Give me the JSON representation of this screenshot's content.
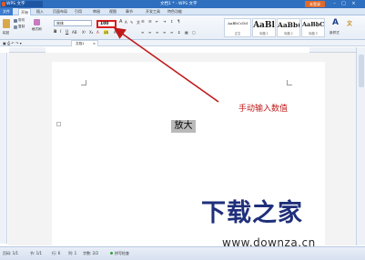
{
  "titlebar": {
    "app_name": "WPS 文字",
    "doc_title": "文档1 * - WPS 文字",
    "login_label": "未登录"
  },
  "menu": {
    "file_label": "文件",
    "start_label": "开始",
    "tabs": [
      "插入",
      "页面布局",
      "引用",
      "审阅",
      "视图",
      "章节",
      "开发工具",
      "特色功能"
    ]
  },
  "ribbon": {
    "paste_label": "粘贴",
    "cut_label": "剪切",
    "copy_label": "复制",
    "format_painter_label": "格式刷",
    "font_name": "宋体",
    "font_size": "100",
    "styles": [
      {
        "sample": "AaBbCcDd",
        "name": "正文"
      },
      {
        "sample": "AaBl",
        "name": "标题 1"
      },
      {
        "sample": "AaBb(",
        "name": "标题 2"
      },
      {
        "sample": "AaBbC",
        "name": "标题 3"
      }
    ],
    "new_style_label": "新样式"
  },
  "doc_tab": {
    "label": "文档1"
  },
  "document": {
    "text": "放大"
  },
  "annotation": {
    "text": "手动输入数值",
    "color": "#c0191a"
  },
  "statusbar": {
    "page": "页码: 1/1",
    "section": "节: 1/1",
    "row": "行: 6",
    "col": "列: 1",
    "words": "字数: 2/2",
    "spell": "拼写检查"
  },
  "watermark": {
    "logo": "下载之家",
    "url": "www.downza.cn"
  },
  "colors": {
    "title_bar": "#2f6fbf",
    "highlight_box": "#d81e1e",
    "arrow": "#c0191a"
  }
}
